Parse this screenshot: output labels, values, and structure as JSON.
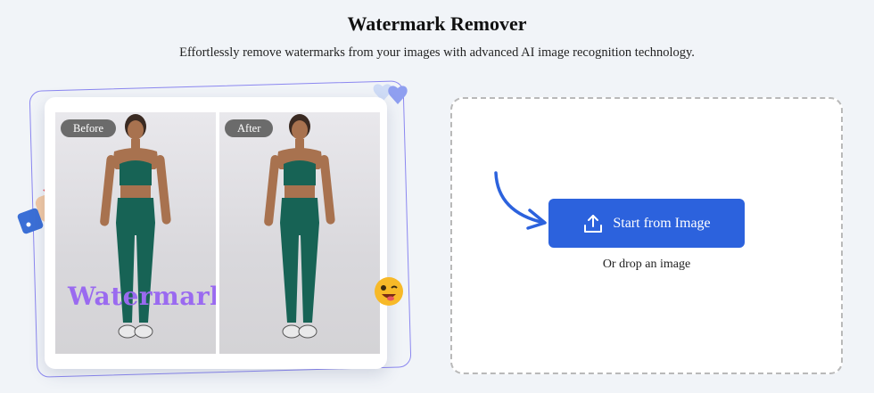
{
  "header": {
    "title": "Watermark Remover",
    "subtitle": "Effortlessly remove watermarks from your images with advanced AI image recognition technology."
  },
  "showcase": {
    "before_label": "Before",
    "after_label": "After",
    "watermark_text": "Watermark"
  },
  "upload": {
    "button_label": "Start from Image",
    "drop_hint": "Or drop an image",
    "icon": "upload-icon"
  },
  "colors": {
    "accent": "#2c62dd",
    "watermark": "#9a6af0",
    "frame": "#8b87f0",
    "outfit": "#176355"
  }
}
